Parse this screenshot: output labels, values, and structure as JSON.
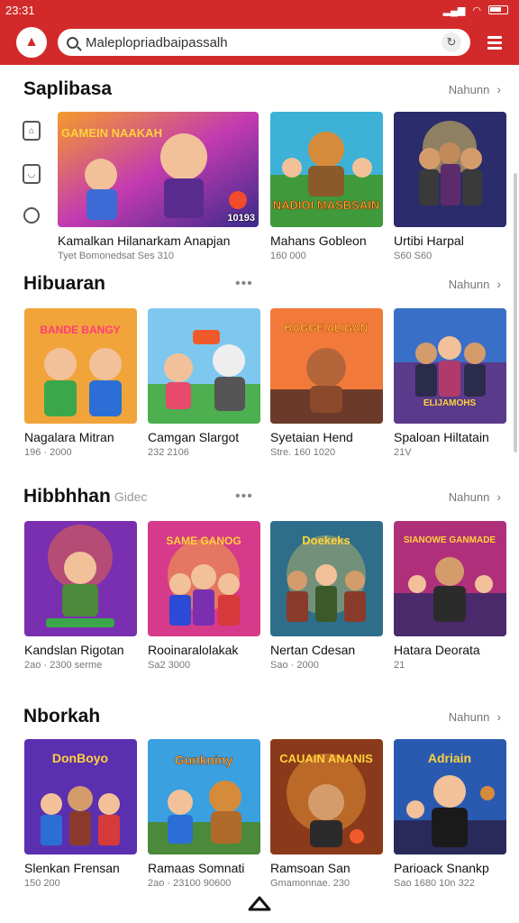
{
  "status": {
    "time": "23:31"
  },
  "search": {
    "value": "Maleplopriadbaipassalh"
  },
  "sections": [
    {
      "title": "Saplibasa",
      "subtitle": "",
      "more": "Nahunn",
      "cards": [
        {
          "title": "Kamalkan Hilanarkam Anapjan",
          "meta": "Tyet Bomonedsat Ses 310",
          "badge": "10193"
        },
        {
          "title": "Mahans Gobleon",
          "meta": "160 000",
          "badge": ""
        },
        {
          "title": "Urtibi Harpal",
          "meta": "S60 S60",
          "badge": ""
        }
      ]
    },
    {
      "title": "Hibuaran",
      "subtitle": "",
      "more": "Nahunn",
      "cards": [
        {
          "title": "Nagalara Mitran",
          "meta": "196 · 2000",
          "badge": ""
        },
        {
          "title": "Camgan Slargot",
          "meta": "232 2106",
          "badge": ""
        },
        {
          "title": "Syetaian Hend",
          "meta": "Stre. 160 1020",
          "badge": ""
        },
        {
          "title": "Spaloan Hiltatain",
          "meta": "21V",
          "badge": ""
        }
      ]
    },
    {
      "title": "Hibbhhan",
      "subtitle": "Gidec",
      "more": "Nahunn",
      "cards": [
        {
          "title": "Kandslan Rigotan",
          "meta": "2ao · 2300 serme",
          "badge": ""
        },
        {
          "title": "Rooinaralolakak",
          "meta": "Sa2 3000",
          "badge": ""
        },
        {
          "title": "Nertan Cdesan",
          "meta": "Sao · 2000",
          "badge": ""
        },
        {
          "title": "Hatara Deorata",
          "meta": "21",
          "badge": ""
        }
      ]
    },
    {
      "title": "Nborkah",
      "subtitle": "",
      "more": "Nahunn",
      "cards": [
        {
          "title": "Slenkan Frensan",
          "meta": "150 200",
          "badge": ""
        },
        {
          "title": "Ramaas Somnati",
          "meta": "2ao · 23100 90600",
          "badge": ""
        },
        {
          "title": "Ramsoan San",
          "meta": "Gmamonnae. 230",
          "badge": ""
        },
        {
          "title": "Parioack Snankp",
          "meta": "Sao 1680 10n 322",
          "badge": ""
        }
      ]
    }
  ],
  "thumb_texts": [
    "GAMEIN NAAKAH",
    "NADIOI MASBSAIN",
    "",
    "BANDE BANGY",
    "",
    "BAGGE ALIGAN",
    "ELIJAMOHS",
    "",
    "SAME GANOG",
    "Doekeks",
    "SIANOWE GANMADE",
    "DonBoyo",
    "Gunkoiny",
    "CAUAIN ANANIS",
    "Adriain"
  ],
  "colors": {
    "brand": "#d22a2a"
  }
}
